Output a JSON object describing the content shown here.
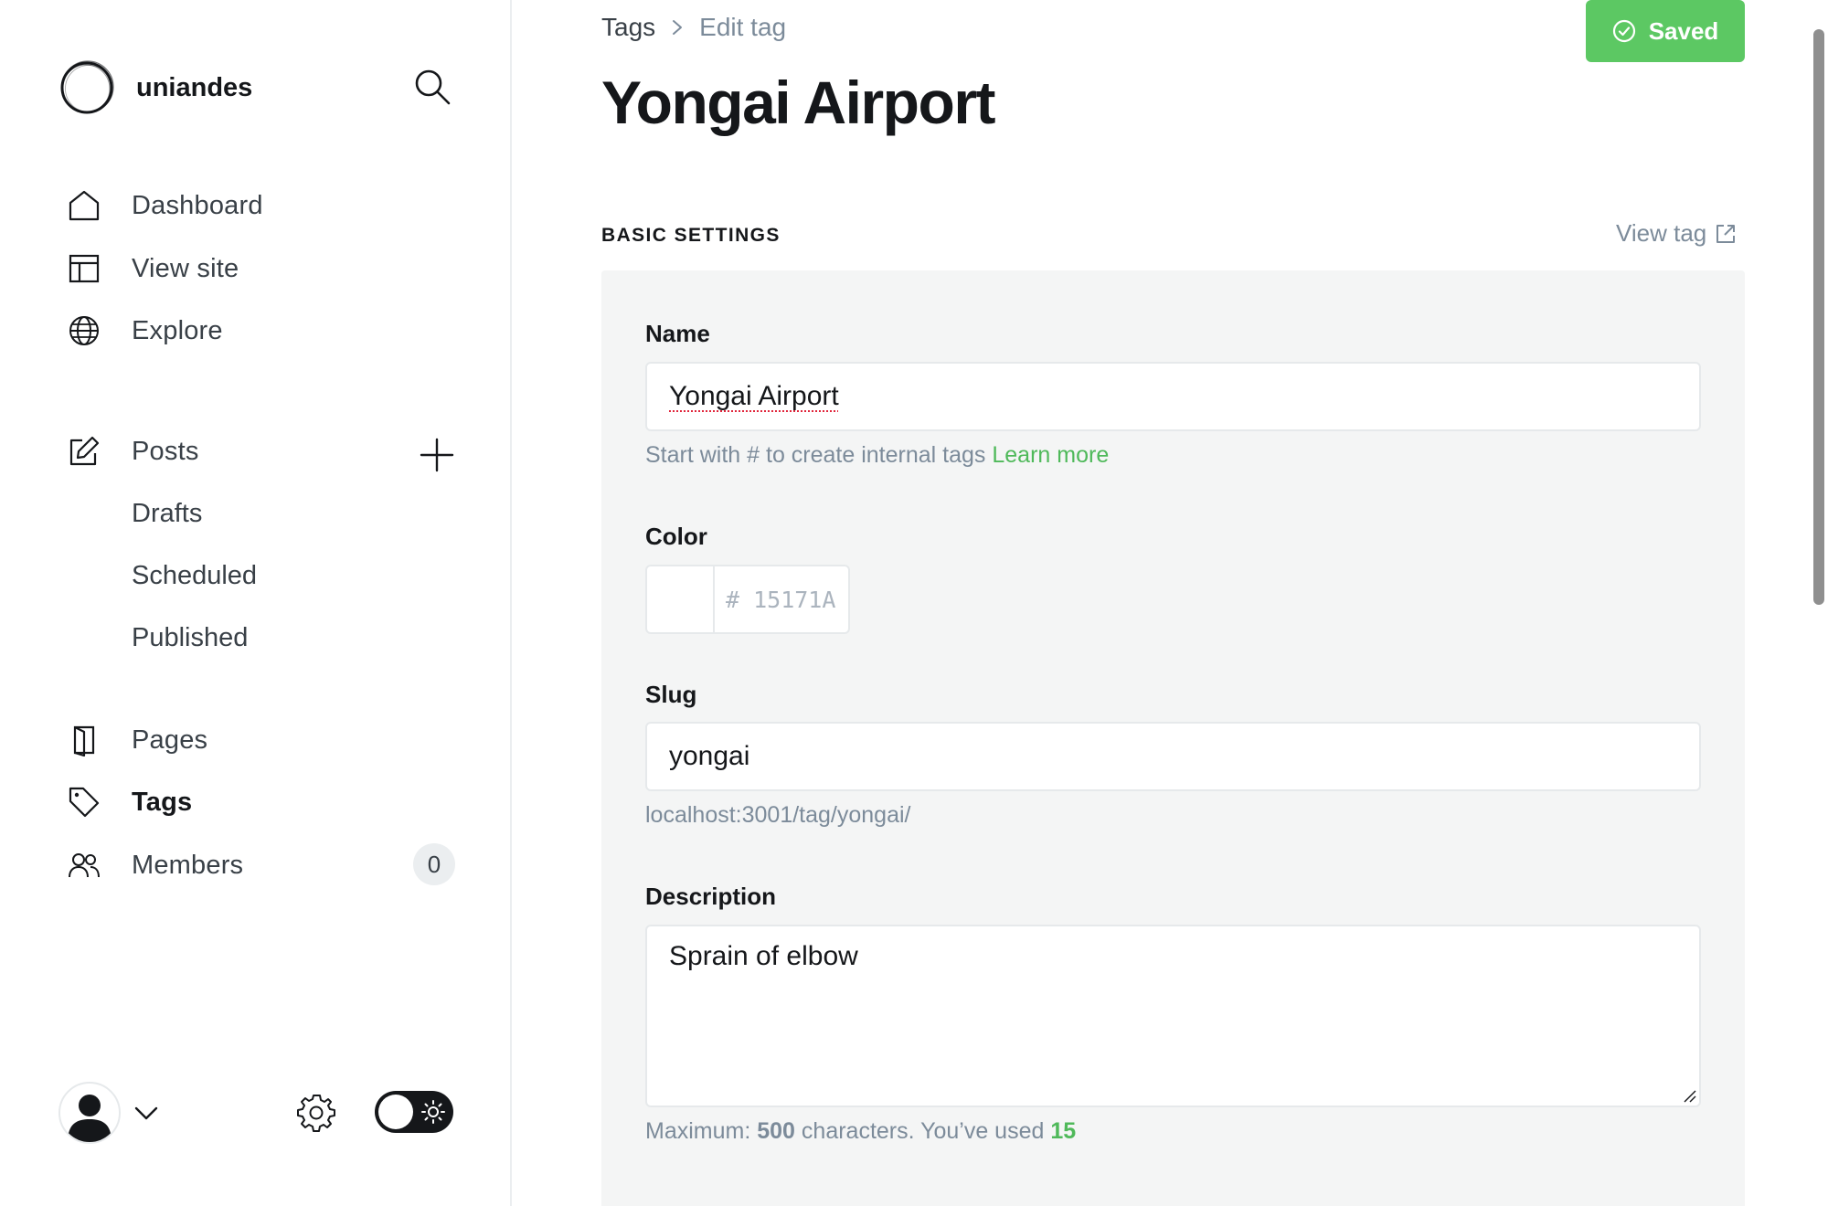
{
  "sidebar": {
    "brand_name": "uniandes",
    "nav_primary": [
      {
        "label": "Dashboard",
        "icon": "home-icon"
      },
      {
        "label": "View site",
        "icon": "layout-icon"
      },
      {
        "label": "Explore",
        "icon": "globe-icon"
      }
    ],
    "posts": {
      "label": "Posts",
      "sub_items": [
        "Drafts",
        "Scheduled",
        "Published"
      ]
    },
    "nav_secondary": [
      {
        "label": "Pages",
        "icon": "page-icon"
      },
      {
        "label": "Tags",
        "icon": "tag-icon",
        "active": true
      },
      {
        "label": "Members",
        "icon": "members-icon",
        "count": "0"
      }
    ]
  },
  "breadcrumb": {
    "root": "Tags",
    "current": "Edit tag"
  },
  "saved_button": {
    "label": "Saved",
    "color": "#5cc863"
  },
  "page_title": "Yongai Airport",
  "basic_settings": {
    "title": "BASIC SETTINGS",
    "view_tag_label": "View tag"
  },
  "form": {
    "name": {
      "label": "Name",
      "value": "Yongai Airport",
      "hint_text": "Start with # to create internal tags",
      "hint_link": "Learn more"
    },
    "color": {
      "label": "Color",
      "placeholder": "# 15171A"
    },
    "slug": {
      "label": "Slug",
      "value": "yongai",
      "url_preview": "localhost:3001/tag/yongai/"
    },
    "description": {
      "label": "Description",
      "value": "Sprain of elbow",
      "counter_prefix": "Maximum:",
      "max_chars": "500",
      "counter_middle": "characters. You’ve used",
      "used_chars": "15"
    }
  },
  "colors": {
    "accent_green": "#5cc863",
    "link_green": "#4fb95a",
    "text_dark": "#15171a",
    "text_muted": "#7c8b9a",
    "panel_bg": "#f4f5f5"
  }
}
